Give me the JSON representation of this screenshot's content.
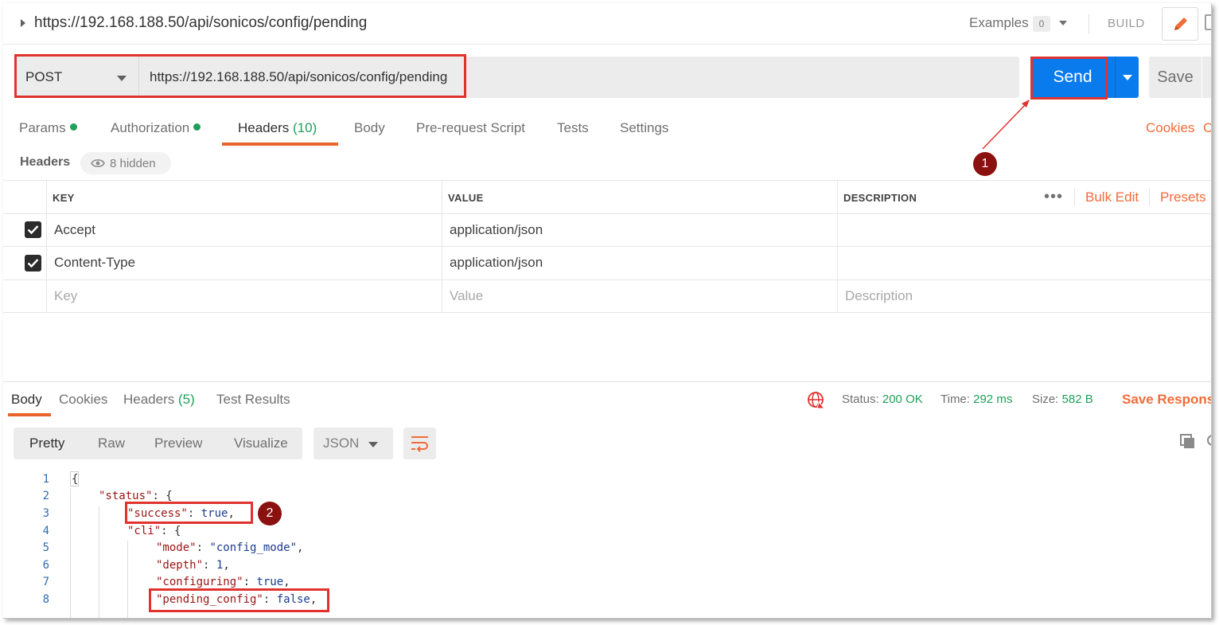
{
  "topbar": {
    "url": "https://192.168.188.50/api/sonicos/config/pending",
    "examples_label": "Examples",
    "examples_count": "0",
    "mode_label": "BUILD",
    "edit_icon": "pencil-icon"
  },
  "request": {
    "method": "POST",
    "url": "https://192.168.188.50/api/sonicos/config/pending",
    "send_label": "Send",
    "save_label": "Save",
    "accent_color": "#097bed"
  },
  "tabs": {
    "params": "Params",
    "authorization": "Authorization",
    "headers": "Headers",
    "headers_count": "(10)",
    "body": "Body",
    "prerequest": "Pre-request Script",
    "tests": "Tests",
    "settings": "Settings",
    "cookies_link": "Cookies",
    "code_link": "C"
  },
  "headers_section": {
    "title": "Headers",
    "hidden_label": "8 hidden"
  },
  "headers_table": {
    "col_key": "KEY",
    "col_value": "VALUE",
    "col_description": "DESCRIPTION",
    "more": "•••",
    "bulk_edit": "Bulk Edit",
    "presets": "Presets",
    "rows": [
      {
        "key": "Accept",
        "value": "application/json",
        "description": "",
        "checked": true
      },
      {
        "key": "Content-Type",
        "value": "application/json",
        "description": "",
        "checked": true
      }
    ],
    "placeholder": {
      "key": "Key",
      "value": "Value",
      "description": "Description"
    }
  },
  "response": {
    "tabs": {
      "body": "Body",
      "cookies": "Cookies",
      "headers": "Headers",
      "headers_count": "(5)",
      "test_results": "Test Results"
    },
    "status_label": "Status:",
    "status_value": "200 OK",
    "time_label": "Time:",
    "time_value": "292 ms",
    "size_label": "Size:",
    "size_value": "582 B",
    "save_response": "Save Response",
    "views": {
      "pretty": "Pretty",
      "raw": "Raw",
      "preview": "Preview",
      "visualize": "Visualize"
    },
    "format": "JSON",
    "line_numbers": [
      "1",
      "2",
      "3",
      "4",
      "5",
      "6",
      "7",
      "8"
    ],
    "code": {
      "l1": "{",
      "l2_key": "\"status\"",
      "l2_rest": ": {",
      "l3_key": "\"success\"",
      "l3_sep": ": ",
      "l3_val": "true",
      "l3_end": ",",
      "l4_key": "\"cli\"",
      "l4_rest": ": {",
      "l5_key": "\"mode\"",
      "l5_sep": ": ",
      "l5_val": "\"config_mode\"",
      "l5_end": ",",
      "l6_key": "\"depth\"",
      "l6_sep": ": ",
      "l6_val": "1",
      "l6_end": ",",
      "l7_key": "\"configuring\"",
      "l7_sep": ": ",
      "l7_val": "true",
      "l7_end": ",",
      "l8_key": "\"pending_config\"",
      "l8_sep": ": ",
      "l8_val": "false",
      "l8_end": ","
    }
  },
  "annotations": {
    "marker_1": "1",
    "marker_2": "2",
    "color": "#e0332e"
  }
}
